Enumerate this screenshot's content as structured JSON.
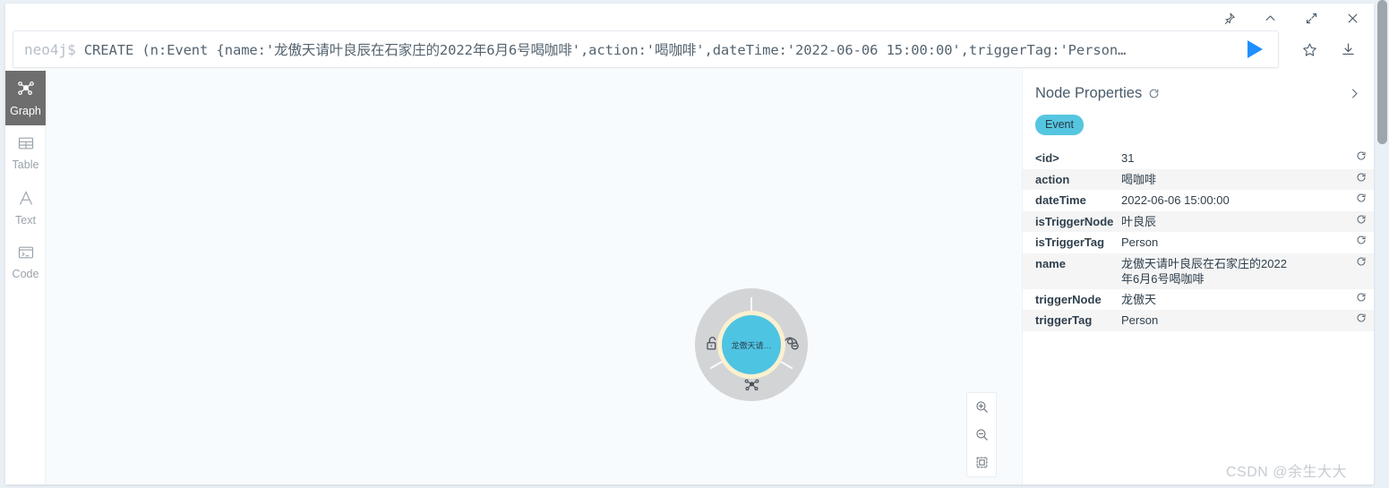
{
  "window": {
    "controls": [
      {
        "name": "pin-icon",
        "label": "Pin"
      },
      {
        "name": "collapse-icon",
        "label": "Collapse"
      },
      {
        "name": "expand-icon",
        "label": "Expand"
      },
      {
        "name": "close-icon",
        "label": "Close"
      }
    ]
  },
  "editor": {
    "prompt": "neo4j$",
    "query": "CREATE (n:Event {name:'龙傲天请叶良辰在石家庄的2022年6月6号喝咖啡',action:'喝咖啡',dateTime:'2022-06-06 15:00:00',triggerTag:'Person…",
    "run_label": "Run query",
    "favorite_label": "Save as favorite",
    "download_label": "Download"
  },
  "sidebar": {
    "items": [
      {
        "label": "Graph",
        "icon": "graph-icon",
        "active": true
      },
      {
        "label": "Table",
        "icon": "table-icon",
        "active": false
      },
      {
        "label": "Text",
        "icon": "text-icon",
        "active": false
      },
      {
        "label": "Code",
        "icon": "code-icon",
        "active": false
      }
    ]
  },
  "graph": {
    "node": {
      "label": "龙傲天请…",
      "fill": "#4ec4e3",
      "halo": "#fbf0cf",
      "ring": "#d2d4d6"
    },
    "context_actions": [
      {
        "name": "unlock-icon",
        "label": "Unlock"
      },
      {
        "name": "hide-icon",
        "label": "Dismiss"
      },
      {
        "name": "expand-node-icon",
        "label": "Expand / Collapse"
      }
    ],
    "zoom_controls": [
      {
        "name": "zoom-in-icon",
        "label": "Zoom in"
      },
      {
        "name": "zoom-out-icon",
        "label": "Zoom out"
      },
      {
        "name": "zoom-fit-icon",
        "label": "Zoom to fit"
      }
    ]
  },
  "properties": {
    "title": "Node Properties",
    "badge": "Event",
    "badge_color": "#56c6e0",
    "rows": [
      {
        "key": "<id>",
        "value": "31"
      },
      {
        "key": "action",
        "value": "喝咖啡"
      },
      {
        "key": "dateTime",
        "value": "2022-06-06 15:00:00"
      },
      {
        "key": "isTriggerNode",
        "value": "叶良辰"
      },
      {
        "key": "isTriggerTag",
        "value": "Person"
      },
      {
        "key": "name",
        "value": "龙傲天请叶良辰在石家庄的2022年6月6号喝咖啡"
      },
      {
        "key": "triggerNode",
        "value": "龙傲天"
      },
      {
        "key": "triggerTag",
        "value": "Person"
      }
    ]
  },
  "watermark": "CSDN @余生大大"
}
